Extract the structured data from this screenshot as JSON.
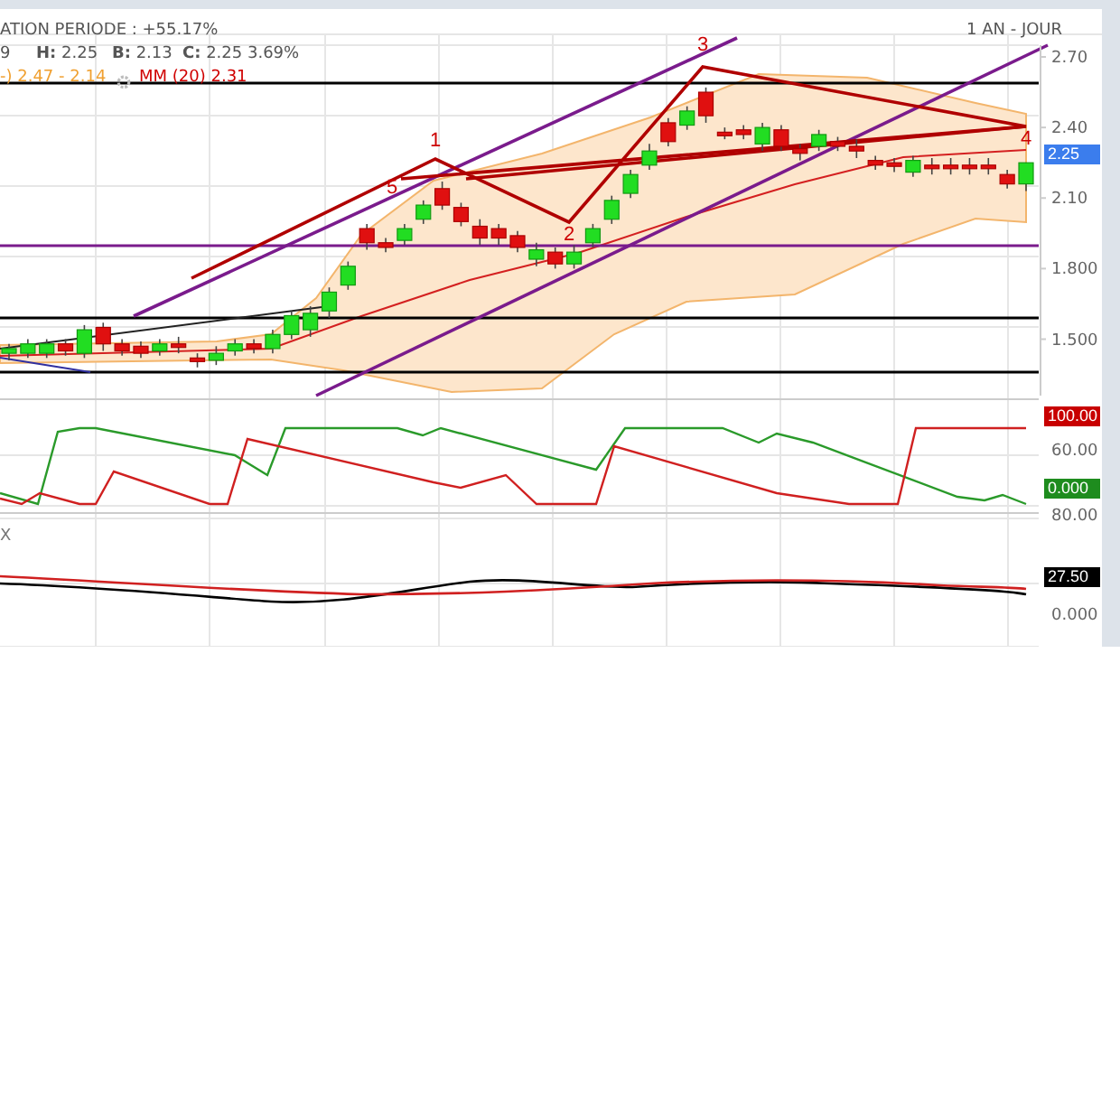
{
  "header": {
    "performance": "ATION PERIODE : +55.17%",
    "period": "1 AN - JOUR"
  },
  "quote": [
    "9",
    "**H:** 2.25",
    "**B:** 2.13",
    "**C:** 2.25 3.69%"
  ],
  "legend": [
    {
      "text": "-) 2.47 - 2.14",
      "color": "#f0a030",
      "settings_icon": false
    },
    {
      "text": "MM (20) 2.31",
      "color": "#d00000",
      "settings_icon": true
    }
  ],
  "wave_labels": [
    "1",
    "5",
    "2",
    "3",
    "4"
  ],
  "price_chart": {
    "chart_data": {
      "type": "candlestick",
      "categories": [
        null,
        null,
        null,
        null,
        null,
        null,
        null,
        null,
        null,
        null,
        null,
        null,
        null,
        null,
        null,
        null,
        null,
        null,
        null,
        null,
        null,
        null,
        null,
        null,
        null,
        null,
        null,
        null,
        null,
        null,
        null,
        null,
        null,
        null,
        null,
        null,
        null,
        null,
        null,
        null,
        null,
        null,
        null,
        null,
        null,
        null,
        null,
        null,
        null,
        null,
        null,
        null,
        null,
        null,
        null
      ],
      "ohlc": [
        [
          1.44,
          1.48,
          1.41,
          1.46
        ],
        [
          1.44,
          1.5,
          1.42,
          1.48
        ],
        [
          1.44,
          1.5,
          1.42,
          1.48
        ],
        [
          1.48,
          1.5,
          1.43,
          1.45
        ],
        [
          1.44,
          1.56,
          1.42,
          1.54
        ],
        [
          1.55,
          1.57,
          1.45,
          1.48
        ],
        [
          1.48,
          1.5,
          1.43,
          1.45
        ],
        [
          1.47,
          1.49,
          1.42,
          1.44
        ],
        [
          1.45,
          1.5,
          1.43,
          1.48
        ],
        [
          1.48,
          1.51,
          1.44,
          1.47
        ],
        [
          1.42,
          1.44,
          1.38,
          1.41
        ],
        [
          1.41,
          1.47,
          1.39,
          1.44
        ],
        [
          1.45,
          1.5,
          1.43,
          1.48
        ],
        [
          1.48,
          1.5,
          1.44,
          1.46
        ],
        [
          1.46,
          1.54,
          1.44,
          1.52
        ],
        [
          1.52,
          1.62,
          1.5,
          1.6
        ],
        [
          1.54,
          1.64,
          1.51,
          1.61
        ],
        [
          1.62,
          1.72,
          1.59,
          1.7
        ],
        [
          1.73,
          1.83,
          1.71,
          1.81
        ],
        [
          1.97,
          1.99,
          1.88,
          1.91
        ],
        [
          1.91,
          1.93,
          1.87,
          1.89
        ],
        [
          1.92,
          1.99,
          1.9,
          1.97
        ],
        [
          2.01,
          2.09,
          1.99,
          2.07
        ],
        [
          2.14,
          2.17,
          2.05,
          2.07
        ],
        [
          2.06,
          2.08,
          1.98,
          2.0
        ],
        [
          1.98,
          2.01,
          1.9,
          1.93
        ],
        [
          1.97,
          1.99,
          1.9,
          1.93
        ],
        [
          1.94,
          1.96,
          1.87,
          1.89
        ],
        [
          1.84,
          1.91,
          1.81,
          1.88
        ],
        [
          1.87,
          1.89,
          1.8,
          1.82
        ],
        [
          1.82,
          1.9,
          1.8,
          1.87
        ],
        [
          1.91,
          1.99,
          1.89,
          1.97
        ],
        [
          2.01,
          2.11,
          1.99,
          2.09
        ],
        [
          2.12,
          2.22,
          2.1,
          2.2
        ],
        [
          2.24,
          2.33,
          2.22,
          2.3
        ],
        [
          2.42,
          2.44,
          2.32,
          2.34
        ],
        [
          2.41,
          2.49,
          2.39,
          2.47
        ],
        [
          2.55,
          2.57,
          2.42,
          2.45
        ],
        [
          2.38,
          2.4,
          2.35,
          2.37
        ],
        [
          2.39,
          2.41,
          2.35,
          2.37
        ],
        [
          2.33,
          2.42,
          2.3,
          2.4
        ],
        [
          2.39,
          2.41,
          2.3,
          2.32
        ],
        [
          2.31,
          2.33,
          2.26,
          2.29
        ],
        [
          2.32,
          2.39,
          2.3,
          2.37
        ],
        [
          2.34,
          2.36,
          2.3,
          2.32
        ],
        [
          2.32,
          2.35,
          2.27,
          2.3
        ],
        [
          2.26,
          2.28,
          2.22,
          2.24
        ],
        [
          2.25,
          2.27,
          2.21,
          2.24
        ],
        [
          2.21,
          2.28,
          2.19,
          2.26
        ],
        [
          2.24,
          2.27,
          2.2,
          2.23
        ],
        [
          2.24,
          2.27,
          2.2,
          2.23
        ],
        [
          2.24,
          2.27,
          2.2,
          2.23
        ],
        [
          2.24,
          2.27,
          2.2,
          2.23
        ],
        [
          2.2,
          2.22,
          2.14,
          2.16
        ],
        [
          2.16,
          2.25,
          2.13,
          2.25
        ]
      ],
      "ylim": [
        1.26,
        2.75
      ],
      "yticks": [
        {
          "value": 2.7,
          "label": "2.70"
        },
        {
          "value": 2.4,
          "label": "2.40"
        },
        {
          "value": 2.1,
          "label": "2.10"
        },
        {
          "value": 1.8,
          "label": "1.800"
        },
        {
          "value": 1.5,
          "label": "1.500"
        }
      ]
    },
    "price_badge": {
      "text": "2.25",
      "color": "#3b7ded"
    }
  },
  "oscillator_axis": [
    {
      "kind": "badge",
      "text": "100.00",
      "color": "#c80000"
    },
    {
      "kind": "tick",
      "text": "60.00"
    },
    {
      "kind": "badge",
      "text": "0.000",
      "color": "#1e8c1e"
    }
  ],
  "indicator_label": "X",
  "indicator_axis": [
    {
      "kind": "tick",
      "text": "80.00"
    },
    {
      "kind": "badge",
      "text": "27.50",
      "color": "#000000"
    },
    {
      "kind": "tick",
      "text": "0.000"
    }
  ]
}
